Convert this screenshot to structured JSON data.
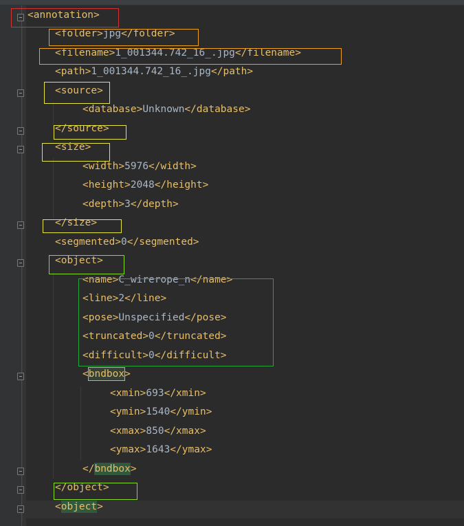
{
  "lines": [
    {
      "open": "<",
      "tag": "annotation",
      "close": ">"
    },
    {
      "open": "<",
      "tag": "folder",
      "close": ">",
      "value": "jpg",
      "end_tag": "</folder>"
    },
    {
      "open": "<",
      "tag": "filename",
      "close": ">",
      "value": "1_001344.742_16_.jpg",
      "end_tag": "</filename>"
    },
    {
      "open": "<",
      "tag": "path",
      "close": ">",
      "value": "1_001344.742_16_.jpg",
      "end_tag": "</path>"
    },
    {
      "open": "<",
      "tag": "source",
      "close": ">"
    },
    {
      "open": "<",
      "tag": "database",
      "close": ">",
      "value": "Unknown",
      "end_tag": "</database>"
    },
    {
      "open": "</",
      "tag": "source",
      "close": ">"
    },
    {
      "open": "<",
      "tag": "size",
      "close": ">"
    },
    {
      "open": "<",
      "tag": "width",
      "close": ">",
      "value": "5976",
      "end_tag": "</width>"
    },
    {
      "open": "<",
      "tag": "height",
      "close": ">",
      "value": "2048",
      "end_tag": "</height>"
    },
    {
      "open": "<",
      "tag": "depth",
      "close": ">",
      "value": "3",
      "end_tag": "</depth>"
    },
    {
      "open": "</",
      "tag": "size",
      "close": ">"
    },
    {
      "open": "<",
      "tag": "segmented",
      "close": ">",
      "value": "0",
      "end_tag": "</segmented>"
    },
    {
      "open": "<",
      "tag": "object",
      "close": ">"
    },
    {
      "open": "<",
      "tag": "name",
      "close": ">",
      "value": "C_wirerope_n",
      "end_tag": "</name>"
    },
    {
      "open": "<",
      "tag": "line",
      "close": ">",
      "value": "2",
      "end_tag": "</line>"
    },
    {
      "open": "<",
      "tag": "pose",
      "close": ">",
      "value": "Unspecified",
      "end_tag": "</pose>"
    },
    {
      "open": "<",
      "tag": "truncated",
      "close": ">",
      "value": "0",
      "end_tag": "</truncated>"
    },
    {
      "open": "<",
      "tag": "difficult",
      "close": ">",
      "value": "0",
      "end_tag": "</difficult>"
    },
    {
      "open": "<",
      "tag": "bndbox",
      "close": ">"
    },
    {
      "open": "<",
      "tag": "xmin",
      "close": ">",
      "value": "693",
      "end_tag": "</xmin>"
    },
    {
      "open": "<",
      "tag": "ymin",
      "close": ">",
      "value": "1540",
      "end_tag": "</ymin>"
    },
    {
      "open": "<",
      "tag": "xmax",
      "close": ">",
      "value": "850",
      "end_tag": "</xmax>"
    },
    {
      "open": "<",
      "tag": "ymax",
      "close": ">",
      "value": "1643",
      "end_tag": "</ymax>"
    },
    {
      "open": "</",
      "tag": "bndbox",
      "close": ">"
    },
    {
      "open": "</",
      "tag": "object",
      "close": ">"
    },
    {
      "open": "<",
      "tag": "object",
      "close": ">"
    }
  ],
  "colors": {
    "background": "#2b2b2b",
    "gutter": "#313335",
    "tag": "#e8bf6a",
    "text": "#a9b7c6",
    "match_highlight": "#32593d"
  },
  "icons": {
    "fold_marker": "fold-toggle-icon"
  }
}
